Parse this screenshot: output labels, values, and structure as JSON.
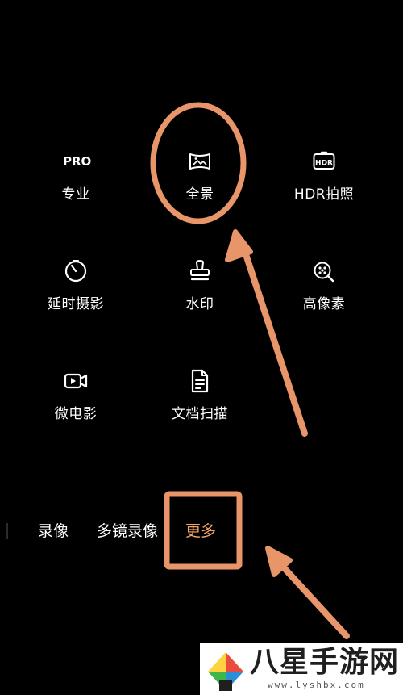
{
  "modes": [
    {
      "id": "pro",
      "label": "专业",
      "icon_text": "PRO",
      "icon": "pro-text-icon"
    },
    {
      "id": "panorama",
      "label": "全景",
      "icon": "panorama-icon"
    },
    {
      "id": "hdr",
      "label": "HDR拍照",
      "icon_text": "HDR",
      "icon": "hdr-icon"
    },
    {
      "id": "timelapse",
      "label": "延时摄影",
      "icon": "timer-icon"
    },
    {
      "id": "watermark",
      "label": "水印",
      "icon": "stamp-icon"
    },
    {
      "id": "highres",
      "label": "高像素",
      "icon": "high-resolution-icon"
    },
    {
      "id": "microfilm",
      "label": "微电影",
      "icon": "video-camera-icon"
    },
    {
      "id": "docscan",
      "label": "文档扫描",
      "icon": "document-icon"
    }
  ],
  "bottom_tabs": [
    {
      "label": "录像",
      "active": false
    },
    {
      "label": "多镜录像",
      "active": false
    },
    {
      "label": "更多",
      "active": true
    }
  ],
  "colors": {
    "background": "#000000",
    "text": "#ffffff",
    "active_tab": "#f3a468",
    "annotation": "#e8956a"
  },
  "site_watermark": {
    "title": "八星手游网",
    "url": "www.lyshbx.com"
  }
}
